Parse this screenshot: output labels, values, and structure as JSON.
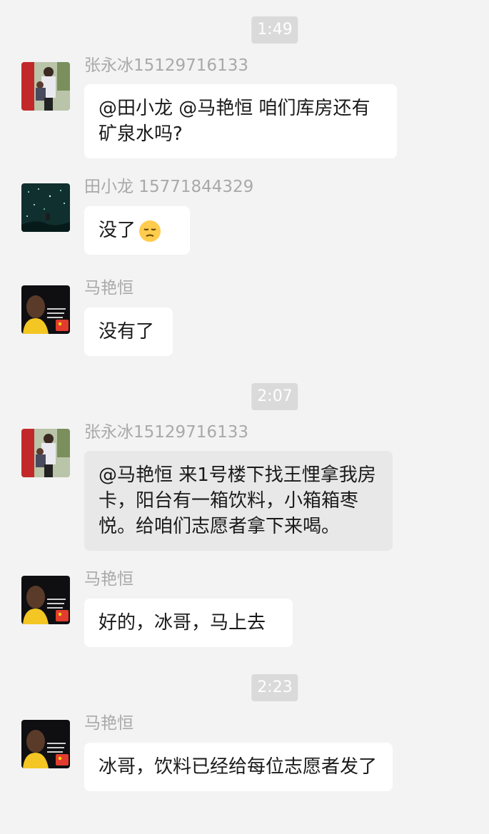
{
  "colors": {
    "background": "#f3f3f3",
    "bubble": "#ffffff",
    "bubble_highlight": "#e8e8e8",
    "time_badge": "#dadada",
    "sender_text": "#a9a9a9"
  },
  "times": [
    "1:49",
    "2:07",
    "2:23"
  ],
  "messages": [
    {
      "sender": "张永冰15129716133",
      "text": "@田小龙 @马艳恒   咱们库房还有矿泉水吗?",
      "avatar": "man-with-child-avatar"
    },
    {
      "sender": "田小龙 15771844329",
      "text": "没了",
      "emoji": "pensive-face-icon",
      "avatar": "night-sky-avatar"
    },
    {
      "sender": "马艳恒",
      "text": "没有了",
      "avatar": "basketball-player-avatar"
    },
    {
      "sender": "张永冰15129716133",
      "text": "@马艳恒 来1号楼下找王悝拿我房卡，阳台有一箱饮料，小箱箱枣悦。给咱们志愿者拿下来喝。",
      "avatar": "man-with-child-avatar",
      "highlighted": true
    },
    {
      "sender": "马艳恒",
      "text": "好的，冰哥，马上去",
      "avatar": "basketball-player-avatar"
    },
    {
      "sender": "马艳恒",
      "text": "冰哥，饮料已经给每位志愿者发了",
      "avatar": "basketball-player-avatar"
    }
  ]
}
